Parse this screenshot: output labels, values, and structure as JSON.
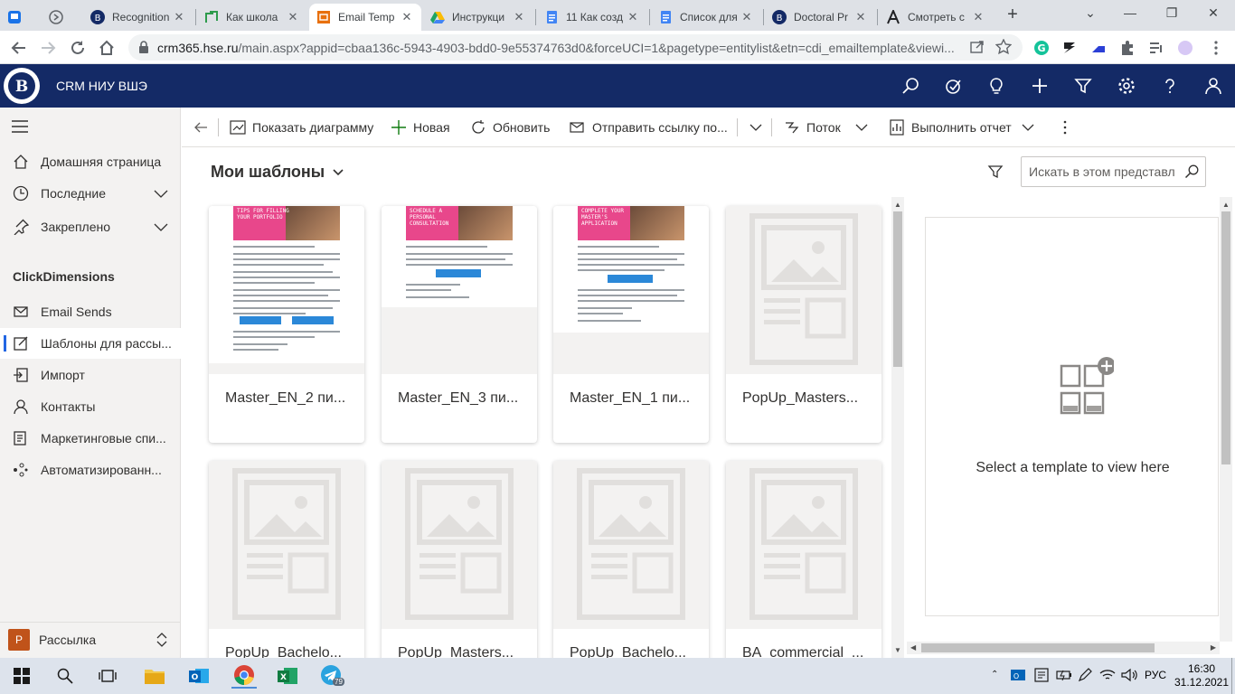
{
  "browser": {
    "tabs": [
      {
        "label": "Recognition",
        "icon": "hse-logo-icon"
      },
      {
        "label": "Как школа",
        "icon": "green-doc-icon"
      },
      {
        "label": "Email Temp",
        "icon": "dynamics-icon",
        "active": true
      },
      {
        "label": "Инструкци",
        "icon": "google-drive-icon"
      },
      {
        "label": "11 Как созд",
        "icon": "google-docs-icon"
      },
      {
        "label": "Список для",
        "icon": "google-docs-icon"
      },
      {
        "label": "Doctoral Pr",
        "icon": "hse-logo-icon"
      },
      {
        "label": "Смотреть с",
        "icon": "a-letter-icon"
      }
    ],
    "url_host": "crm365.hse.ru",
    "url_path": "/main.aspx?appid=cbaa136c-5943-4903-bdd0-9e55374763d0&forceUCI=1&pagetype=entitylist&etn=cdi_emailtemplate&viewi..."
  },
  "crm": {
    "app_name": "CRM НИУ ВШЭ"
  },
  "nav": {
    "items": [
      {
        "label": "Домашняя страница",
        "icon": "home-icon"
      },
      {
        "label": "Последние",
        "icon": "clock-icon",
        "chevron": true
      },
      {
        "label": "Закреплено",
        "icon": "pin-icon",
        "chevron": true
      }
    ],
    "section": "ClickDimensions",
    "section_items": [
      {
        "label": "Email Sends",
        "icon": "mail-icon"
      },
      {
        "label": "Шаблоны для рассы...",
        "icon": "template-icon",
        "selected": true
      },
      {
        "label": "Импорт",
        "icon": "import-icon"
      },
      {
        "label": "Контакты",
        "icon": "person-icon"
      },
      {
        "label": "Маркетинговые спи...",
        "icon": "list-icon"
      },
      {
        "label": "Автоматизированн...",
        "icon": "flow-icon"
      }
    ],
    "area": {
      "badge": "Р",
      "label": "Рассылка"
    }
  },
  "commands": {
    "show_chart": "Показать диаграмму",
    "new": "Новая",
    "refresh": "Обновить",
    "send_link": "Отправить ссылку по...",
    "flow": "Поток",
    "run_report": "Выполнить отчет"
  },
  "view": {
    "title": "Мои шаблоны",
    "search_placeholder": "Искать в этом представл"
  },
  "templates": [
    {
      "name": "Master_EN_2 пи...",
      "preview": "email",
      "banner": "TIPS FOR FILLING YOUR PORTFOLIO"
    },
    {
      "name": "Master_EN_3 пи...",
      "preview": "email",
      "banner": "SCHEDULE A PERSONAL CONSULTATION"
    },
    {
      "name": "Master_EN_1 пи...",
      "preview": "email",
      "banner": "COMPLETE YOUR MASTER'S APPLICATION"
    },
    {
      "name": "PopUp_Masters...",
      "preview": "placeholder"
    },
    {
      "name": "PopUp_Bachelo...",
      "preview": "placeholder"
    },
    {
      "name": "PopUp_Masters...",
      "preview": "placeholder"
    },
    {
      "name": "PopUp_Bachelo...",
      "preview": "placeholder"
    },
    {
      "name": "BA_commercial_...",
      "preview": "placeholder"
    }
  ],
  "preview_pane": {
    "message": "Select a template to view here"
  },
  "taskbar": {
    "lang": "РУС",
    "time": "16:30",
    "date": "31.12.2021",
    "telegram_badge": "79"
  }
}
